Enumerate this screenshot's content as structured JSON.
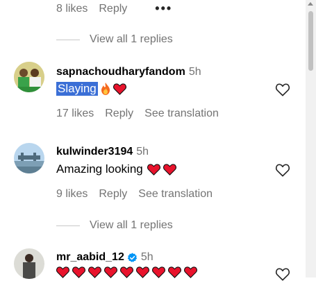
{
  "top": {
    "likes": "8 likes",
    "reply": "Reply",
    "more": "•••",
    "view_replies": "View all 1 replies"
  },
  "comments": [
    {
      "username": "sapnachoudharyfandom",
      "time": "5h",
      "text": "Slaying",
      "likes": "17 likes",
      "reply": "Reply",
      "translate": "See translation"
    },
    {
      "username": "kulwinder3194",
      "time": "5h",
      "text": "Amazing looking",
      "likes": "9 likes",
      "reply": "Reply",
      "translate": "See translation",
      "view_replies": "View all 1 replies"
    },
    {
      "username": "mr_aabid_12",
      "time": "5h",
      "verified": true
    }
  ],
  "colors": {
    "heart": "#e8132c",
    "selection": "#3b6fd6",
    "muted": "#737373",
    "verified": "#0095f6"
  }
}
